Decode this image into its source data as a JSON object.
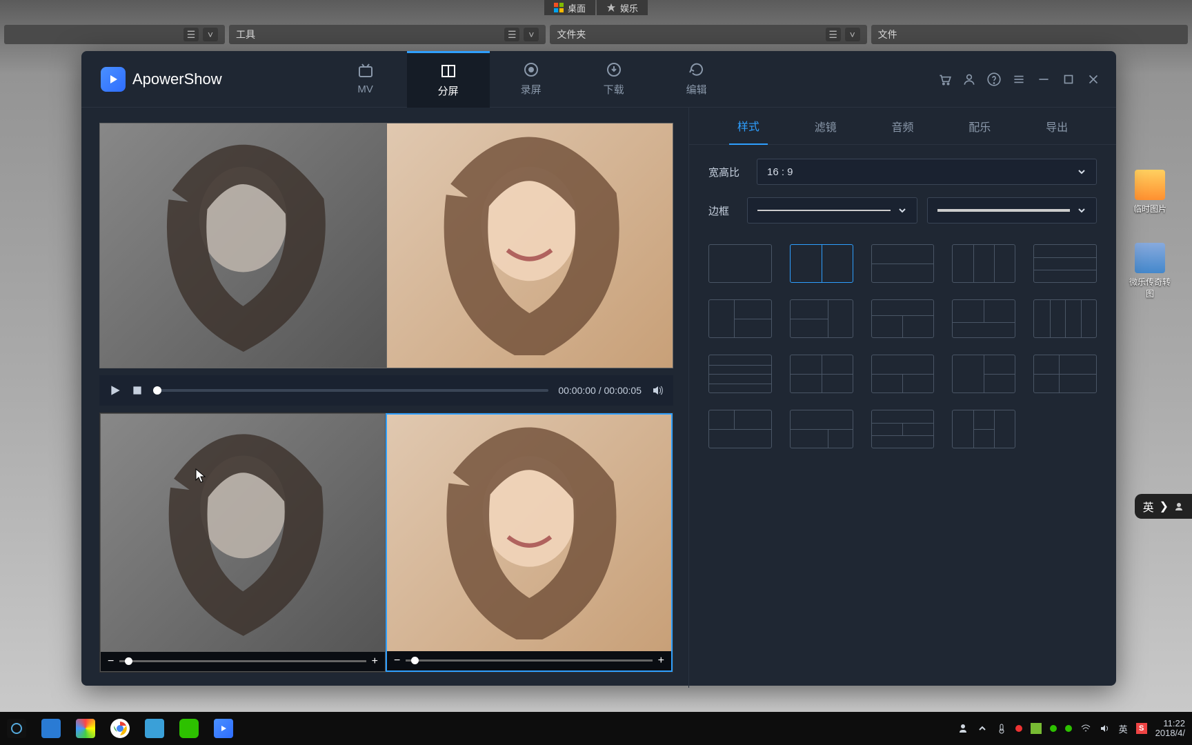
{
  "system_tabs": {
    "desktop": "桌面",
    "entertainment": "娱乐"
  },
  "strips": {
    "tools": "工具",
    "folder": "文件夹",
    "file": "文件"
  },
  "app": {
    "name": "ApowerShow",
    "nav": {
      "mv": "MV",
      "split": "分屏",
      "record": "录屏",
      "download": "下载",
      "edit": "编辑"
    },
    "tabs": {
      "style": "样式",
      "filter": "滤镜",
      "audio": "音频",
      "music": "配乐",
      "export": "导出"
    },
    "labels": {
      "aspect": "宽高比",
      "border": "边框"
    },
    "aspect_value": "16 : 9",
    "time": "00:00:00 / 00:00:05"
  },
  "desktop_icons": {
    "temp_img": "临时图片",
    "promo_img": "微乐传奇转图"
  },
  "ime": "英",
  "tray": {
    "ime_short": "英",
    "time": "11:22",
    "date": "2018/4/"
  }
}
